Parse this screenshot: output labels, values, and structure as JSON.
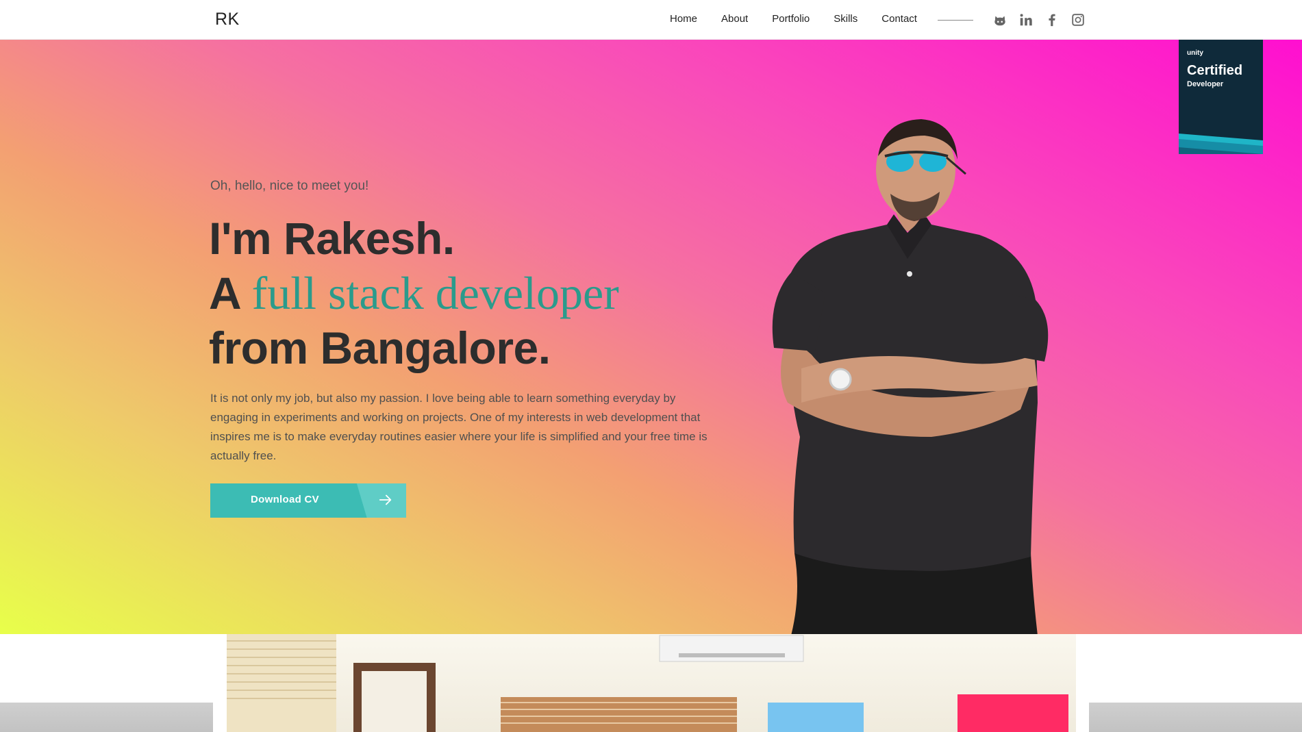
{
  "header": {
    "logo": "RK",
    "nav": [
      "Home",
      "About",
      "Portfolio",
      "Skills",
      "Contact"
    ],
    "social_icons": [
      "github-icon",
      "linkedin-icon",
      "facebook-icon",
      "instagram-icon"
    ]
  },
  "hero": {
    "greeting": "Oh, hello, nice to meet you!",
    "line1": "I'm Rakesh.",
    "line2_prefix": "A",
    "line2_accent": "full stack developer",
    "line3": "from Bangalore.",
    "description": "It is not only my job, but also my passion. I love being able to learn something everyday by engaging in experiments and working on projects. One of my interests in web development that inspires me is to make everyday routines easier where your life is simplified and your free time is actually free.",
    "cta_label": "Download CV",
    "accent_color": "#2a9b8c",
    "button_color": "#3cbcb4"
  },
  "badge": {
    "brand": "unity",
    "title": "Certified",
    "subtitle": "Developer"
  }
}
